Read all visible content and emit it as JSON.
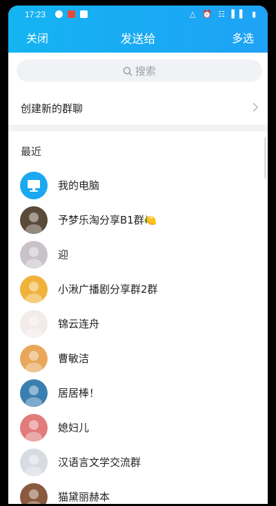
{
  "status_bar": {
    "time": "17:23",
    "icons_right": "△ ⏰ ☷ ▌▌ ▮"
  },
  "nav": {
    "left_label": "关闭",
    "title": "发送给",
    "right_label": "多选"
  },
  "search": {
    "placeholder": "搜索"
  },
  "create_group": {
    "label": "创建新的群聊"
  },
  "recent": {
    "title": "最近",
    "items": [
      {
        "name": "我的电脑",
        "avatar": "computer-icon",
        "color": "#1aa8f0"
      },
      {
        "name": "予梦乐淘分享B1群🍋",
        "avatar": "photo",
        "color": "#5a4a3a"
      },
      {
        "name": "迎",
        "avatar": "cat-photo",
        "color": "#c9c3c9"
      },
      {
        "name": "小湫广播剧分享群2群",
        "avatar": "anime-photo",
        "color": "#f0b23a"
      },
      {
        "name": "锦云连舟",
        "avatar": "art-photo",
        "color": "#f3eaea"
      },
      {
        "name": "曹敏洁",
        "avatar": "illustration",
        "color": "#e8a75a"
      },
      {
        "name": "居居棒！",
        "avatar": "cartoon-photo",
        "color": "#3a7fb0"
      },
      {
        "name": "媳妇儿",
        "avatar": "anime-photo",
        "color": "#e27b7b"
      },
      {
        "name": "汉语言文学交流群",
        "avatar": "person-photo",
        "color": "#d7dbe2"
      },
      {
        "name": "猫黛丽赫本",
        "avatar": "photo",
        "color": "#8a5a40"
      }
    ]
  }
}
